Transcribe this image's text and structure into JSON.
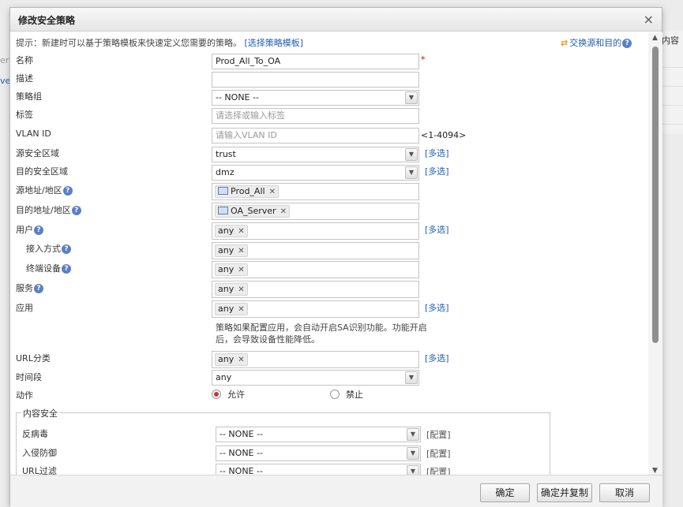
{
  "dialog": {
    "title": "修改安全策略",
    "close_symbol": "×"
  },
  "background": {
    "left_fragments": [
      "er",
      "ve"
    ],
    "right_header": "内容"
  },
  "hint": {
    "text": "提示：新建时可以基于策略模板来快速定义您需要的策略。",
    "link": "[选择策略模板]"
  },
  "swap": {
    "label": "交换源和目的",
    "help": "?"
  },
  "fields": {
    "name": {
      "label": "名称",
      "value": "Prod_All_To_OA",
      "required_mark": "*"
    },
    "description": {
      "label": "描述",
      "value": ""
    },
    "policy_group": {
      "label": "策略组",
      "value": "-- NONE --"
    },
    "tags": {
      "label": "标签",
      "placeholder": "请选择或输入标签"
    },
    "vlan": {
      "label": "VLAN ID",
      "placeholder": "请输入VLAN ID",
      "range": "<1-4094>"
    },
    "src_zone": {
      "label": "源安全区域",
      "value": "trust",
      "multi": "[多选]"
    },
    "dst_zone": {
      "label": "目的安全区域",
      "value": "dmz",
      "multi": "[多选]"
    },
    "src_addr": {
      "label": "源地址/地区",
      "tag": "Prod_All"
    },
    "dst_addr": {
      "label": "目的地址/地区",
      "tag": "OA_Server"
    },
    "user": {
      "label": "用户",
      "tag": "any",
      "multi": "[多选]"
    },
    "access_mode": {
      "label": "接入方式",
      "tag": "any"
    },
    "terminal": {
      "label": "终端设备",
      "tag": "any"
    },
    "service": {
      "label": "服务",
      "tag": "any"
    },
    "application": {
      "label": "应用",
      "tag": "any",
      "multi": "[多选]",
      "note": "策略如果配置应用，会自动开启SA识别功能。功能开启后，会导致设备性能降低。"
    },
    "url_category": {
      "label": "URL分类",
      "tag": "any",
      "multi": "[多选]"
    },
    "schedule": {
      "label": "时间段",
      "value": "any"
    },
    "action": {
      "label": "动作",
      "allow": "允许",
      "deny": "禁止",
      "selected": "allow"
    }
  },
  "content_security": {
    "legend": "内容安全",
    "rows": [
      {
        "label": "反病毒",
        "value": "-- NONE --",
        "config": "[配置]"
      },
      {
        "label": "入侵防御",
        "value": "-- NONE --",
        "config": "[配置]"
      },
      {
        "label": "URL过滤",
        "value": "-- NONE --",
        "config": "[配置]"
      }
    ]
  },
  "footer": {
    "ok": "确定",
    "ok_copy": "确定并复制",
    "cancel": "取消"
  },
  "icons": {
    "help": "question-circle-icon",
    "remove": "close-icon",
    "dropdown": "chevron-down-icon",
    "address": "computer-icon",
    "swap": "swap-arrows-icon"
  },
  "colors": {
    "link": "#1f5fb4",
    "required": "#cc0000",
    "help_icon": "#5b7fc7",
    "radio_selected": "#cc3333"
  }
}
